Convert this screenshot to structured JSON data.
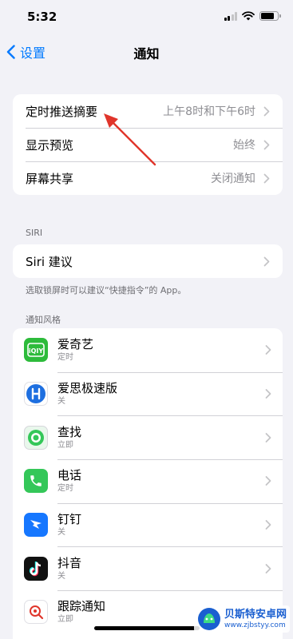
{
  "status_bar": {
    "time": "5:32"
  },
  "nav": {
    "back_label": "设置",
    "title": "通知"
  },
  "group_schedule": [
    {
      "label": "定时推送摘要",
      "value": "上午8时和下午6时"
    },
    {
      "label": "显示预览",
      "value": "始终"
    },
    {
      "label": "屏幕共享",
      "value": "关闭通知"
    }
  ],
  "siri": {
    "header": "SIRI",
    "row_label": "Siri 建议",
    "footnote": "选取锁屏时可以建议“快捷指令”的 App。"
  },
  "notification_style": {
    "header": "通知风格",
    "apps": [
      {
        "name": "爱奇艺",
        "sub": "定时",
        "icon": "iqiyi-icon",
        "color": "#2dbb3b"
      },
      {
        "name": "爱思极速版",
        "sub": "关",
        "icon": "aisi-icon",
        "color": "#1e6fe0"
      },
      {
        "name": "查找",
        "sub": "立即",
        "icon": "findmy-icon",
        "color": "#34c759"
      },
      {
        "name": "电话",
        "sub": "定时",
        "icon": "phone-icon",
        "color": "#34c759"
      },
      {
        "name": "钉钉",
        "sub": "关",
        "icon": "dingtalk-icon",
        "color": "#1677ff"
      },
      {
        "name": "抖音",
        "sub": "关",
        "icon": "douyin-icon",
        "color": "#111111"
      },
      {
        "name": "跟踪通知",
        "sub": "立即",
        "icon": "tracking-icon",
        "color": "#ffffff"
      }
    ]
  },
  "watermark": {
    "title": "贝斯特安卓网",
    "url": "www.zjbstyy.com"
  },
  "colors": {
    "accent": "#007aff",
    "background": "#f2f2f7",
    "annotation": "#e0352b"
  }
}
